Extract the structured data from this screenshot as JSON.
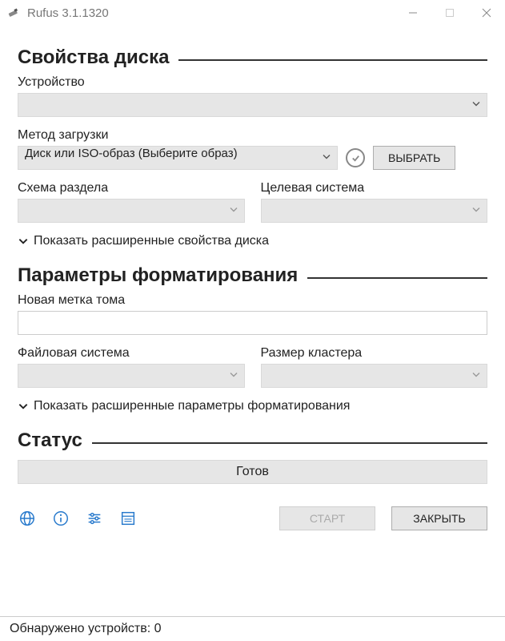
{
  "window": {
    "title": "Rufus 3.1.1320"
  },
  "sections": {
    "drive_properties": "Свойства диска",
    "format_options": "Параметры форматирования",
    "status": "Статус"
  },
  "labels": {
    "device": "Устройство",
    "boot_selection": "Метод загрузки",
    "partition_scheme": "Схема раздела",
    "target_system": "Целевая система",
    "volume_label": "Новая метка тома",
    "file_system": "Файловая система",
    "cluster_size": "Размер кластера"
  },
  "values": {
    "device": "",
    "boot_selection": "Диск или ISO-образ (Выберите образ)",
    "partition_scheme": "",
    "target_system": "",
    "volume_label": "",
    "file_system": "",
    "cluster_size": ""
  },
  "buttons": {
    "select": "ВЫБРАТЬ",
    "start": "СТАРТ",
    "close": "ЗАКРЫТЬ"
  },
  "expanders": {
    "drive": "Показать расширенные свойства диска",
    "format": "Показать расширенные параметры форматирования"
  },
  "status_text": "Готов",
  "footer": "Обнаружено устройств: 0"
}
